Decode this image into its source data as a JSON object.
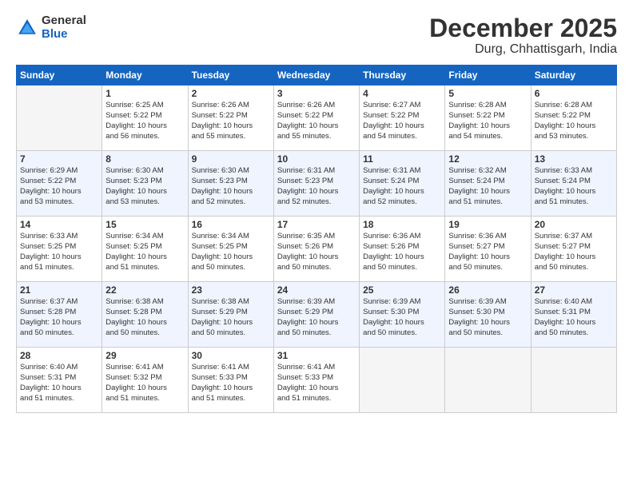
{
  "logo": {
    "general": "General",
    "blue": "Blue"
  },
  "title": {
    "month": "December 2025",
    "location": "Durg, Chhattisgarh, India"
  },
  "headers": [
    "Sunday",
    "Monday",
    "Tuesday",
    "Wednesday",
    "Thursday",
    "Friday",
    "Saturday"
  ],
  "weeks": [
    [
      {
        "num": "",
        "info": ""
      },
      {
        "num": "1",
        "info": "Sunrise: 6:25 AM\nSunset: 5:22 PM\nDaylight: 10 hours\nand 56 minutes."
      },
      {
        "num": "2",
        "info": "Sunrise: 6:26 AM\nSunset: 5:22 PM\nDaylight: 10 hours\nand 55 minutes."
      },
      {
        "num": "3",
        "info": "Sunrise: 6:26 AM\nSunset: 5:22 PM\nDaylight: 10 hours\nand 55 minutes."
      },
      {
        "num": "4",
        "info": "Sunrise: 6:27 AM\nSunset: 5:22 PM\nDaylight: 10 hours\nand 54 minutes."
      },
      {
        "num": "5",
        "info": "Sunrise: 6:28 AM\nSunset: 5:22 PM\nDaylight: 10 hours\nand 54 minutes."
      },
      {
        "num": "6",
        "info": "Sunrise: 6:28 AM\nSunset: 5:22 PM\nDaylight: 10 hours\nand 53 minutes."
      }
    ],
    [
      {
        "num": "7",
        "info": "Sunrise: 6:29 AM\nSunset: 5:22 PM\nDaylight: 10 hours\nand 53 minutes."
      },
      {
        "num": "8",
        "info": "Sunrise: 6:30 AM\nSunset: 5:23 PM\nDaylight: 10 hours\nand 53 minutes."
      },
      {
        "num": "9",
        "info": "Sunrise: 6:30 AM\nSunset: 5:23 PM\nDaylight: 10 hours\nand 52 minutes."
      },
      {
        "num": "10",
        "info": "Sunrise: 6:31 AM\nSunset: 5:23 PM\nDaylight: 10 hours\nand 52 minutes."
      },
      {
        "num": "11",
        "info": "Sunrise: 6:31 AM\nSunset: 5:24 PM\nDaylight: 10 hours\nand 52 minutes."
      },
      {
        "num": "12",
        "info": "Sunrise: 6:32 AM\nSunset: 5:24 PM\nDaylight: 10 hours\nand 51 minutes."
      },
      {
        "num": "13",
        "info": "Sunrise: 6:33 AM\nSunset: 5:24 PM\nDaylight: 10 hours\nand 51 minutes."
      }
    ],
    [
      {
        "num": "14",
        "info": "Sunrise: 6:33 AM\nSunset: 5:25 PM\nDaylight: 10 hours\nand 51 minutes."
      },
      {
        "num": "15",
        "info": "Sunrise: 6:34 AM\nSunset: 5:25 PM\nDaylight: 10 hours\nand 51 minutes."
      },
      {
        "num": "16",
        "info": "Sunrise: 6:34 AM\nSunset: 5:25 PM\nDaylight: 10 hours\nand 50 minutes."
      },
      {
        "num": "17",
        "info": "Sunrise: 6:35 AM\nSunset: 5:26 PM\nDaylight: 10 hours\nand 50 minutes."
      },
      {
        "num": "18",
        "info": "Sunrise: 6:36 AM\nSunset: 5:26 PM\nDaylight: 10 hours\nand 50 minutes."
      },
      {
        "num": "19",
        "info": "Sunrise: 6:36 AM\nSunset: 5:27 PM\nDaylight: 10 hours\nand 50 minutes."
      },
      {
        "num": "20",
        "info": "Sunrise: 6:37 AM\nSunset: 5:27 PM\nDaylight: 10 hours\nand 50 minutes."
      }
    ],
    [
      {
        "num": "21",
        "info": "Sunrise: 6:37 AM\nSunset: 5:28 PM\nDaylight: 10 hours\nand 50 minutes."
      },
      {
        "num": "22",
        "info": "Sunrise: 6:38 AM\nSunset: 5:28 PM\nDaylight: 10 hours\nand 50 minutes."
      },
      {
        "num": "23",
        "info": "Sunrise: 6:38 AM\nSunset: 5:29 PM\nDaylight: 10 hours\nand 50 minutes."
      },
      {
        "num": "24",
        "info": "Sunrise: 6:39 AM\nSunset: 5:29 PM\nDaylight: 10 hours\nand 50 minutes."
      },
      {
        "num": "25",
        "info": "Sunrise: 6:39 AM\nSunset: 5:30 PM\nDaylight: 10 hours\nand 50 minutes."
      },
      {
        "num": "26",
        "info": "Sunrise: 6:39 AM\nSunset: 5:30 PM\nDaylight: 10 hours\nand 50 minutes."
      },
      {
        "num": "27",
        "info": "Sunrise: 6:40 AM\nSunset: 5:31 PM\nDaylight: 10 hours\nand 50 minutes."
      }
    ],
    [
      {
        "num": "28",
        "info": "Sunrise: 6:40 AM\nSunset: 5:31 PM\nDaylight: 10 hours\nand 51 minutes."
      },
      {
        "num": "29",
        "info": "Sunrise: 6:41 AM\nSunset: 5:32 PM\nDaylight: 10 hours\nand 51 minutes."
      },
      {
        "num": "30",
        "info": "Sunrise: 6:41 AM\nSunset: 5:33 PM\nDaylight: 10 hours\nand 51 minutes."
      },
      {
        "num": "31",
        "info": "Sunrise: 6:41 AM\nSunset: 5:33 PM\nDaylight: 10 hours\nand 51 minutes."
      },
      {
        "num": "",
        "info": ""
      },
      {
        "num": "",
        "info": ""
      },
      {
        "num": "",
        "info": ""
      }
    ]
  ]
}
